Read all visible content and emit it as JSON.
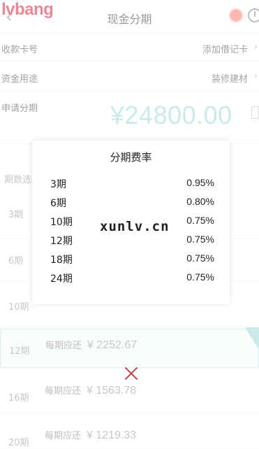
{
  "brand_watermark": "lvbang",
  "header": {
    "title": "现金分期"
  },
  "form": {
    "card_label": "收款卡号",
    "card_value": "添加借记卡",
    "purpose_label": "资金用途",
    "purpose_value": "装修建材",
    "apply_label": "申请分期",
    "amount": "¥24800.00",
    "period_select_label": "期数选择"
  },
  "periods": [
    {
      "name": "3期"
    },
    {
      "name": "6期"
    },
    {
      "name": "10期"
    },
    {
      "name": "12期",
      "repay_label": "每期应还",
      "repay_amount": "¥ 2252.67"
    },
    {
      "name": "16期",
      "repay_label": "每期应还",
      "repay_amount": "¥ 1563.78"
    },
    {
      "name": "20期",
      "repay_label": "每期应还",
      "repay_amount": "¥ 1219.33"
    }
  ],
  "popup": {
    "title": "分期费率",
    "rates": [
      {
        "period": "3期",
        "rate": "0.95%"
      },
      {
        "period": "6期",
        "rate": "0.80%"
      },
      {
        "period": "10期",
        "rate": "0.75%"
      },
      {
        "period": "12期",
        "rate": "0.75%"
      },
      {
        "period": "18期",
        "rate": "0.75%"
      },
      {
        "period": "24期",
        "rate": "0.75%"
      }
    ]
  },
  "center_watermark": "xunlv.cn",
  "colors": {
    "accent": "#9fd9d4",
    "brand_watermark": "#d8263a",
    "close": "#c0474f"
  }
}
